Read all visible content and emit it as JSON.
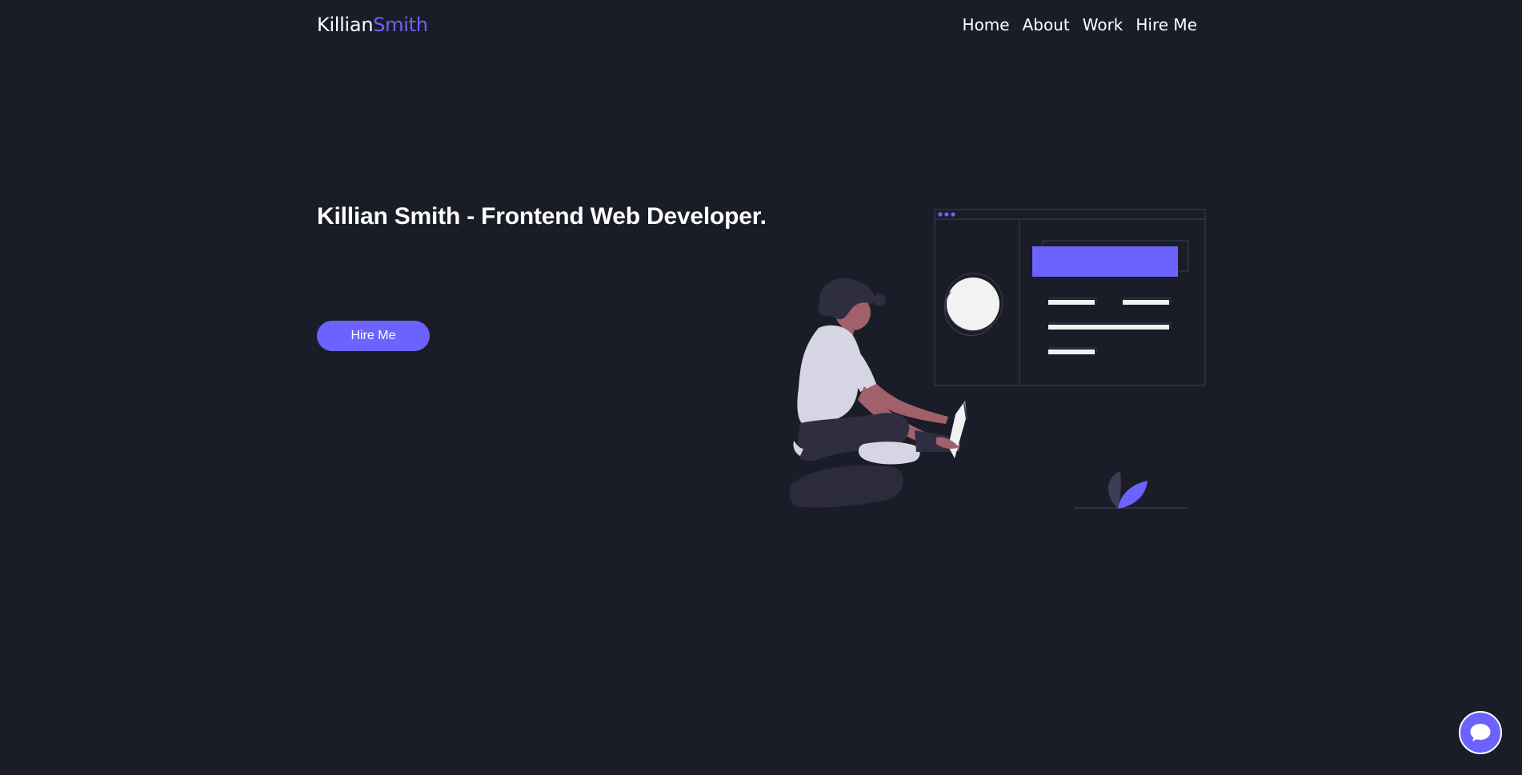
{
  "header": {
    "logo_first": "Killian",
    "logo_second": "Smith",
    "nav": [
      "Home",
      "About",
      "Work",
      "Hire Me"
    ]
  },
  "hero": {
    "title": "Killian Smith - Frontend Web Developer.",
    "cta_label": "Hire Me"
  },
  "icons": {
    "chat": "chat-bubble-icon",
    "illustration": "developer-with-laptop-illustration"
  },
  "colors": {
    "background": "#1a1d27",
    "accent": "#6c63ff",
    "text": "#ffffff"
  }
}
